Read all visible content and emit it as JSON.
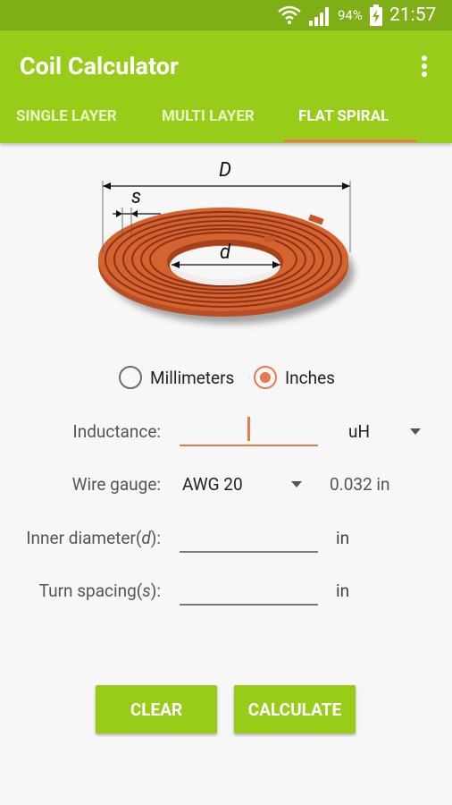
{
  "status_bar": {
    "battery_percent": "94%",
    "time": "21:57",
    "icons": [
      "wifi-icon",
      "signal-icon",
      "battery-charging-icon"
    ]
  },
  "app_bar": {
    "title": "Coil Calculator",
    "menu_icon": "overflow-menu-icon",
    "tabs": [
      {
        "label": "SINGLE LAYER",
        "active": false
      },
      {
        "label": "MULTI LAYER",
        "active": false
      },
      {
        "label": "FLAT SPIRAL",
        "active": true
      }
    ]
  },
  "diagram": {
    "outer_diameter_label": "D",
    "inner_diameter_label": "d",
    "spacing_label": "s",
    "coil_color": "#c8552c"
  },
  "units": {
    "options": [
      {
        "label": "Millimeters",
        "checked": false
      },
      {
        "label": "Inches",
        "checked": true
      }
    ]
  },
  "form": {
    "inductance": {
      "label": "Inductance:",
      "value": "",
      "unit": "uH"
    },
    "wire_gauge": {
      "label": "Wire gauge:",
      "value": "AWG 20",
      "diameter": "0.032 in"
    },
    "inner_diameter": {
      "label_prefix": "Inner diameter(",
      "label_var": "d",
      "label_suffix": "):",
      "value": "",
      "unit": "in"
    },
    "turn_spacing": {
      "label_prefix": "Turn spacing(",
      "label_var": "s",
      "label_suffix": "):",
      "value": "",
      "unit": "in"
    }
  },
  "buttons": {
    "clear": "CLEAR",
    "calculate": "CALCULATE"
  },
  "colors": {
    "primary": "#99cc19",
    "primary_dark": "#7fae16",
    "accent": "#e77a4e"
  }
}
